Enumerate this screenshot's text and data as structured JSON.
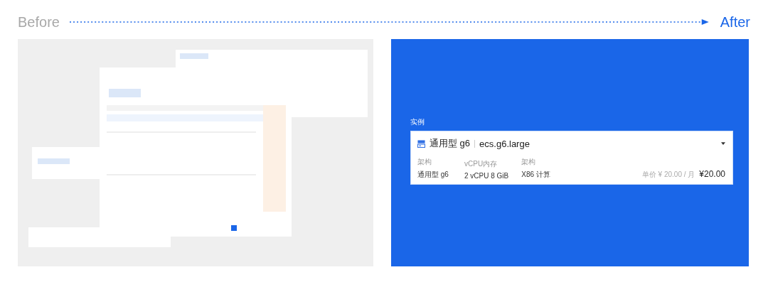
{
  "header": {
    "before_label": "Before",
    "after_label": "After"
  },
  "after_panel": {
    "section_label": "实例",
    "instance": {
      "family": "通用型 g6",
      "spec": "ecs.g6.large",
      "fields": [
        {
          "label": "架构",
          "value": "通用型 g6"
        },
        {
          "label": "vCPU内存",
          "value": "2 vCPU 8 GiB"
        },
        {
          "label": "架构",
          "value": "X86 计算"
        }
      ],
      "unit_price": "单价 ¥ 20.00 / 月",
      "price": "¥20.00"
    }
  }
}
